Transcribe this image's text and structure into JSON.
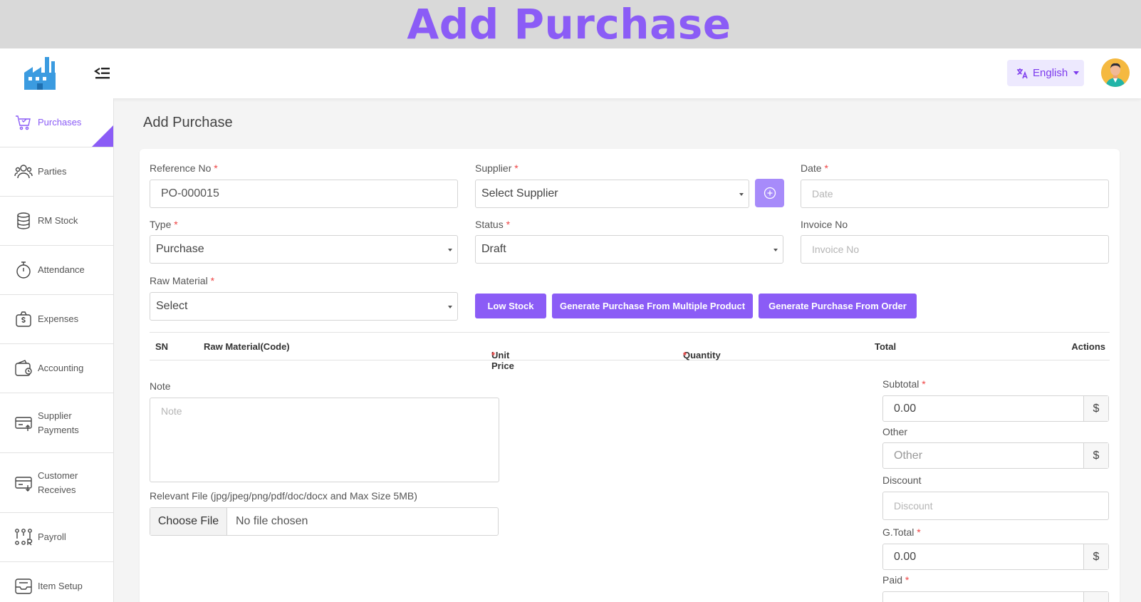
{
  "banner": {
    "title": "Add Purchase"
  },
  "topbar": {
    "language": "English"
  },
  "sidebar": {
    "items": [
      {
        "label": "Purchases",
        "icon": "cart-icon"
      },
      {
        "label": "Parties",
        "icon": "users-icon"
      },
      {
        "label": "RM Stock",
        "icon": "database-icon"
      },
      {
        "label": "Attendance",
        "icon": "stopwatch-icon"
      },
      {
        "label": "Expenses",
        "icon": "money-bag-icon"
      },
      {
        "label": "Accounting",
        "icon": "wallet-icon"
      },
      {
        "label": "Supplier\nPayments",
        "icon": "card-out-icon"
      },
      {
        "label": "Customer\nReceives",
        "icon": "card-in-icon"
      },
      {
        "label": "Payroll",
        "icon": "payroll-icon"
      },
      {
        "label": "Item Setup",
        "icon": "inbox-icon"
      }
    ]
  },
  "page": {
    "title": "Add Purchase"
  },
  "form": {
    "reference": {
      "label": "Reference No",
      "required": "*",
      "value": "PO-000015"
    },
    "supplier": {
      "label": "Supplier",
      "required": "*",
      "value": "Select Supplier"
    },
    "date": {
      "label": "Date",
      "required": "*",
      "placeholder": "Date"
    },
    "type": {
      "label": "Type",
      "required": "*",
      "value": "Purchase"
    },
    "status": {
      "label": "Status",
      "required": "*",
      "value": "Draft"
    },
    "invoice": {
      "label": "Invoice No",
      "placeholder": "Invoice No"
    },
    "raw_material": {
      "label": "Raw Material",
      "required": "*",
      "value": "Select"
    },
    "buttons": {
      "low_stock": "Low Stock",
      "multi_product": "Generate Purchase From Multiple Product",
      "from_order": "Generate Purchase From Order"
    },
    "table": {
      "sn": "SN",
      "raw_material": "Raw Material(Code)",
      "unit_price": "Unit Price",
      "quantity": "Quantity",
      "total": "Total",
      "actions": "Actions",
      "required": "*"
    },
    "note": {
      "label": "Note",
      "placeholder": "Note"
    },
    "file": {
      "label": "Relevant File (jpg/jpeg/png/pdf/doc/docx and Max Size 5MB)",
      "button": "Choose File",
      "status": "No file chosen"
    },
    "subtotal": {
      "label": "Subtotal",
      "required": "*",
      "value": "0.00",
      "addon": "$"
    },
    "other": {
      "label": "Other",
      "placeholder": "Other",
      "addon": "$"
    },
    "discount": {
      "label": "Discount",
      "placeholder": "Discount"
    },
    "gtotal": {
      "label": "G.Total",
      "required": "*",
      "value": "0.00",
      "addon": "$"
    },
    "paid": {
      "label": "Paid",
      "required": "*"
    }
  },
  "colors": {
    "accent": "#8b5cf6",
    "required": "#ef4444"
  }
}
